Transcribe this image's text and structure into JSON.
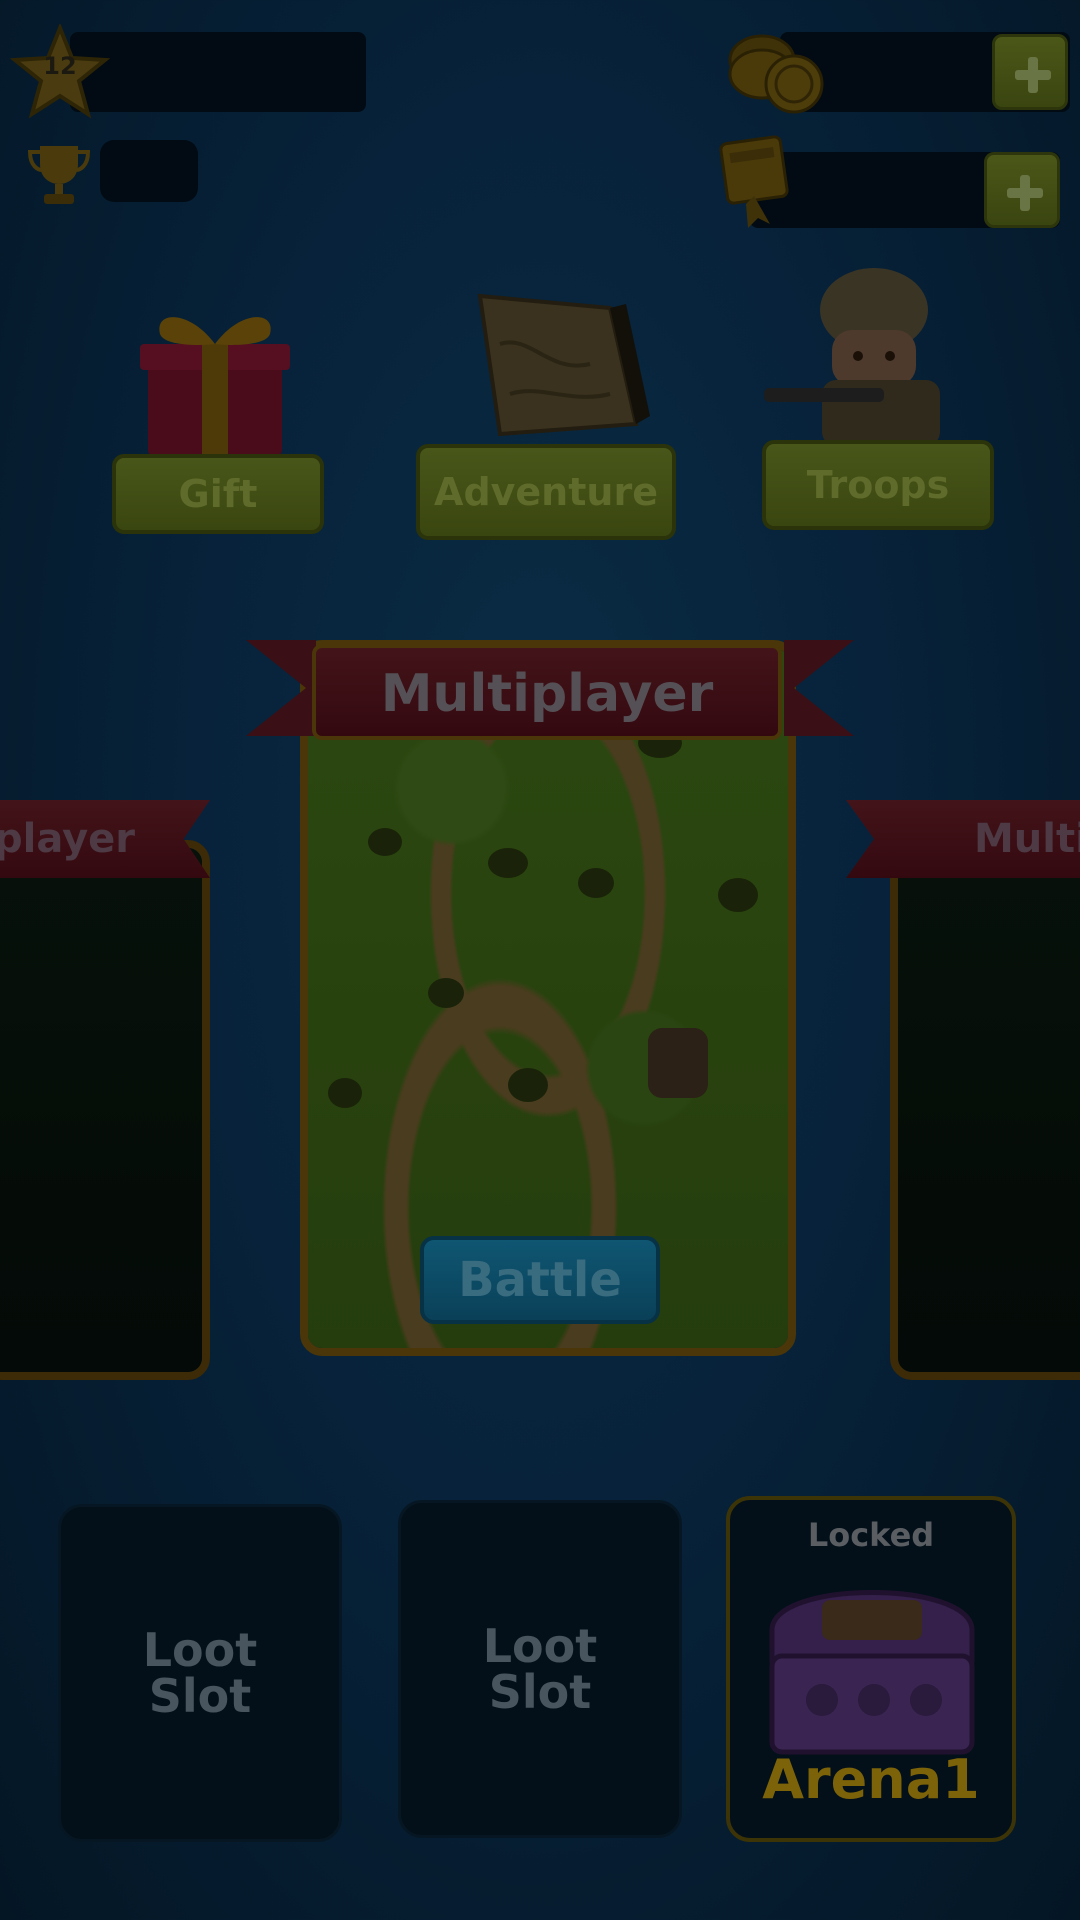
{
  "player": {
    "level": "12",
    "trophies": ""
  },
  "menu": {
    "gift_label": "Gift",
    "adventure_label": "Adventure",
    "troops_label": "Troops"
  },
  "cards": {
    "left_title": "player",
    "center_title": "Multiplayer",
    "right_title": "Multi",
    "battle_label": "Battle"
  },
  "slots": [
    {
      "label": "Loot Slot"
    },
    {
      "label": "Loot Slot"
    },
    {
      "status": "Locked",
      "arena": "Arena1"
    }
  ],
  "colors": {
    "overlay_bg": "#07223a",
    "ribbon": "#43141a",
    "green_button": "#48561a",
    "blue_button": "#0b4a63",
    "arena_text": "#7c6208"
  },
  "icons": [
    "star-icon",
    "trophy-icon",
    "coins-icon",
    "ticket-icon",
    "plus-icon",
    "gift-icon",
    "map-scroll-icon",
    "soldier-icon",
    "chest-icon"
  ]
}
